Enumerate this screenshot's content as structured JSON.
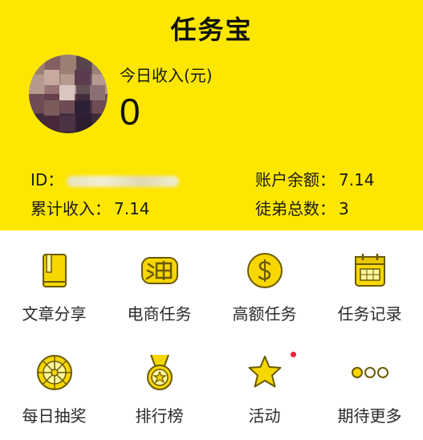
{
  "header": {
    "title": "任务宝",
    "today_income_label": "今日收入(元)",
    "today_income_value": "0",
    "id_label": "ID：",
    "balance_label": "账户余额：",
    "balance_value": "7.14",
    "total_income_label": "累计收入：",
    "total_income_value": "7.14",
    "apprentice_label": "徒弟总数：",
    "apprentice_value": "3"
  },
  "menu": {
    "items": [
      {
        "label": "文章分享",
        "icon": "book-icon"
      },
      {
        "label": "电商任务",
        "icon": "taobao-icon"
      },
      {
        "label": "高额任务",
        "icon": "dollar-coin-icon"
      },
      {
        "label": "任务记录",
        "icon": "calendar-icon"
      },
      {
        "label": "每日抽奖",
        "icon": "lottery-wheel-icon"
      },
      {
        "label": "排行榜",
        "icon": "medal-icon"
      },
      {
        "label": "活动",
        "icon": "star-icon"
      },
      {
        "label": "期待更多",
        "icon": "more-dots-icon"
      }
    ]
  },
  "colors": {
    "brand_yellow": "#FDE700",
    "icon_yellow": "#F7D700",
    "icon_stroke": "#6b5a00",
    "notification_red": "#f0203a"
  }
}
